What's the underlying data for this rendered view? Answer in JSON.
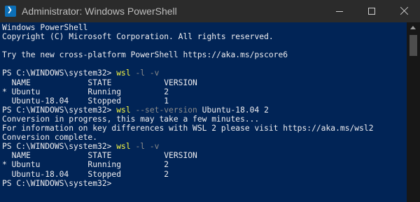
{
  "window": {
    "title": "Administrator: Windows PowerShell",
    "app_icon_glyph": "❯_",
    "controls": [
      "minimize-icon",
      "maximize-icon",
      "close-icon"
    ]
  },
  "colors": {
    "console_bg": "#012456",
    "console_fg": "#eeedf0",
    "command": "#f5f543",
    "parameter": "#8a8a8a",
    "titlebar": "#2b2b2b"
  },
  "console": {
    "lines": [
      {
        "text": "Windows PowerShell"
      },
      {
        "text": "Copyright (C) Microsoft Corporation. All rights reserved."
      },
      {
        "text": ""
      },
      {
        "text": "Try the new cross-platform PowerShell https://aka.ms/pscore6"
      },
      {
        "text": ""
      },
      {
        "prompt": "PS C:\\WINDOWS\\system32> ",
        "cmd": "wsl",
        "args": " -l -v",
        "rest": ""
      },
      {
        "text": "  NAME            STATE           VERSION"
      },
      {
        "text": "* Ubuntu          Running         2"
      },
      {
        "text": "  Ubuntu-18.04    Stopped         1"
      },
      {
        "prompt": "PS C:\\WINDOWS\\system32> ",
        "cmd": "wsl",
        "args": " --set-version",
        "rest": " Ubuntu-18.04 2"
      },
      {
        "text": "Conversion in progress, this may take a few minutes..."
      },
      {
        "text": "For information on key differences with WSL 2 please visit https://aka.ms/wsl2"
      },
      {
        "text": "Conversion complete."
      },
      {
        "prompt": "PS C:\\WINDOWS\\system32> ",
        "cmd": "wsl",
        "args": " -l -v",
        "rest": ""
      },
      {
        "text": "  NAME            STATE           VERSION"
      },
      {
        "text": "* Ubuntu          Running         2"
      },
      {
        "text": "  Ubuntu-18.04    Stopped         2"
      },
      {
        "prompt": "PS C:\\WINDOWS\\system32> ",
        "cmd": "",
        "args": "",
        "rest": ""
      }
    ]
  }
}
